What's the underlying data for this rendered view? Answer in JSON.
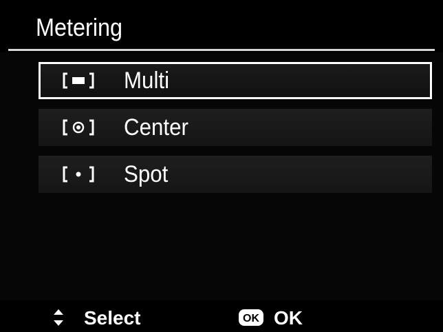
{
  "header": {
    "title": "Metering"
  },
  "menu": {
    "items": [
      {
        "label": "Multi",
        "icon": "multi-metering-icon",
        "selected": true
      },
      {
        "label": "Center",
        "icon": "center-weighted-metering-icon",
        "selected": false
      },
      {
        "label": "Spot",
        "icon": "spot-metering-icon",
        "selected": false
      }
    ]
  },
  "footer": {
    "select_label": "Select",
    "select_icon": "up-down-arrows-icon",
    "ok_label": "OK",
    "ok_icon": "ok-button-icon",
    "ok_icon_text": "OK"
  },
  "colors": {
    "background": "#000000",
    "text": "#ffffff",
    "selection_border": "#ffffff",
    "row_background": "#1c1c1c"
  }
}
